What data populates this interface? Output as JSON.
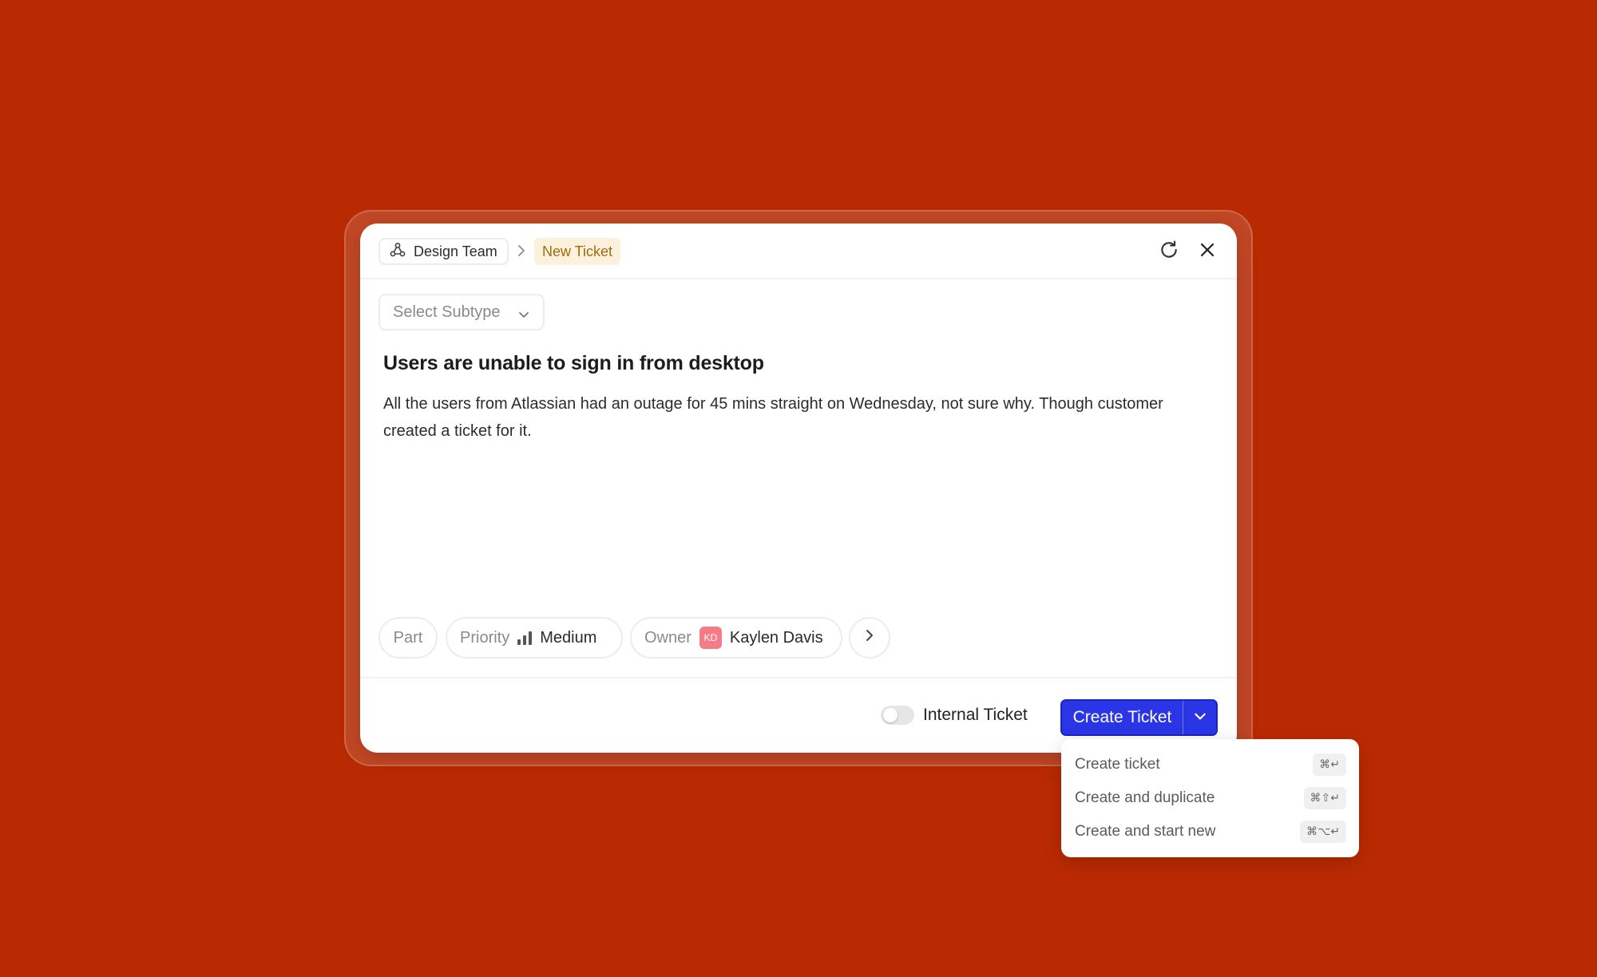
{
  "breadcrumb": {
    "team": "Design Team",
    "current": "New Ticket"
  },
  "subtype": {
    "placeholder": "Select Subtype"
  },
  "ticket": {
    "title": "Users are unable to sign in from desktop",
    "description": "All the users from Atlassian had an outage for 45 mins straight on Wednesday, not sure why. Though customer created a ticket for it."
  },
  "fields": {
    "part_label": "Part",
    "priority_label": "Priority",
    "priority_value": "Medium",
    "owner_label": "Owner",
    "owner_initials": "KD",
    "owner_name": "Kaylen Davis"
  },
  "footer": {
    "internal_label": "Internal Ticket",
    "internal_enabled": false,
    "create_label": "Create Ticket"
  },
  "menu": {
    "items": [
      {
        "label": "Create ticket",
        "shortcut": "⌘↵"
      },
      {
        "label": "Create and duplicate",
        "shortcut": "⌘⇧↵"
      },
      {
        "label": "Create and start new",
        "shortcut": "⌘⌥↵"
      }
    ]
  },
  "colors": {
    "background": "#BA2A02",
    "accent": "#2A35E6",
    "tag_bg": "#FBF1DC",
    "tag_text": "#A26A0B",
    "avatar": "#F57B87"
  },
  "icons": {
    "team": "team-nodes-icon",
    "separator": "chevron-right-icon",
    "refresh": "refresh-icon",
    "close": "close-icon",
    "subtype_caret": "chevron-down-icon",
    "priority": "priority-bars-icon",
    "more": "chevron-right-icon",
    "create_caret": "chevron-down-icon"
  }
}
